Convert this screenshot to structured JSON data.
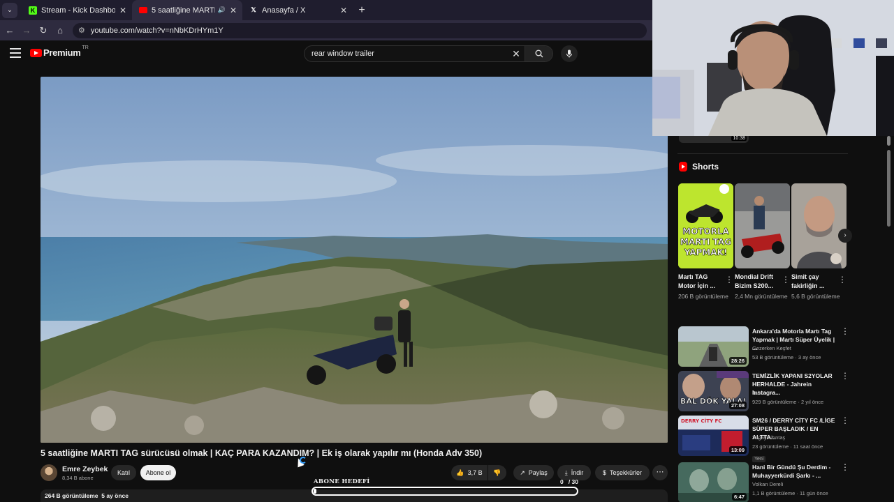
{
  "browser": {
    "tabs": [
      {
        "label": "Stream - Kick Dashboard",
        "favicon": "kick-icon"
      },
      {
        "label": "5 saatliğine MARTI TAG sür",
        "favicon": "youtube-icon",
        "active": true
      },
      {
        "label": "Anasayfa / X",
        "favicon": "x-icon"
      }
    ],
    "close_glyph": "✕",
    "newtab_glyph": "+",
    "url": "youtube.com/watch?v=nNbKDrHYm1Y"
  },
  "youtube": {
    "logo_text": "Premium",
    "country": "TR",
    "search_query": "rear window trailer"
  },
  "video": {
    "title": "5 saatliğine MARTI TAG sürücüsü olmak | KAÇ PARA KAZANDIM? | Ek iş olarak yapılır mı (Honda Adv 350)",
    "channel_name": "Emre Zeybek",
    "subscribers": "8,34 B abone",
    "join_label": "Katıl",
    "subscribe_label": "Abone ol",
    "likes": "3,7 B",
    "share_label": "Paylaş",
    "download_label": "İndir",
    "thanks_label": "Teşekkürler",
    "views": "264 B görüntüleme",
    "age": "5 ay önce"
  },
  "subscriber_goal": {
    "label": "ABONE HEDEFİ",
    "current": "0",
    "target": "/ 30",
    "progress": 0.01
  },
  "shorts": {
    "heading": "Shorts",
    "items": [
      {
        "title": "Martı TAG Motor İçin ...",
        "views": "206 B görüntüleme",
        "overlay": [
          "MOTORLA",
          "MARTI TAG",
          "YAPMAK!"
        ]
      },
      {
        "title": "Mondial Drift Bizim S200...",
        "views": "2,4 Mn görüntüleme"
      },
      {
        "title": "Simit çay fakirliğin ...",
        "views": "5,6 B görüntüleme"
      }
    ]
  },
  "recommendations": [
    {
      "title": "Ankara'da Motorla Martı Tag Yapmak | Martı Süper Üyelik | ...",
      "channel": "Gezerken Keşfet",
      "meta": "53 B görüntüleme · 3 ay önce",
      "duration": "28:26"
    },
    {
      "title": "TEMİZLİK YAPANI S2YOLAR HERHALDE - Jahrein Instagra...",
      "channel": "Jahrein",
      "meta": "929 B görüntüleme · 2 yıl önce",
      "duration": "27:08",
      "overlay": "BAL DÖK YALA!"
    },
    {
      "title": "SM26 / DERRY CİTY FC /LİGE SÜPER BAŞLADIK / EN ALTTA...",
      "channel": "Tugay Altıntaş",
      "meta": "23 görüntüleme · 11 saat önce",
      "duration": "13:09",
      "badge": "Yeni",
      "overlay": "DERRY CİTY FC"
    },
    {
      "title": "Hani Bir Gündü Şu Derdim - Muhayyerkürdi Şarkı - ...",
      "channel": "Volkan Dereli",
      "meta": "1,1 B görüntüleme · 11 gün önce",
      "duration": "6:47"
    }
  ],
  "prev_duration": "10:38"
}
